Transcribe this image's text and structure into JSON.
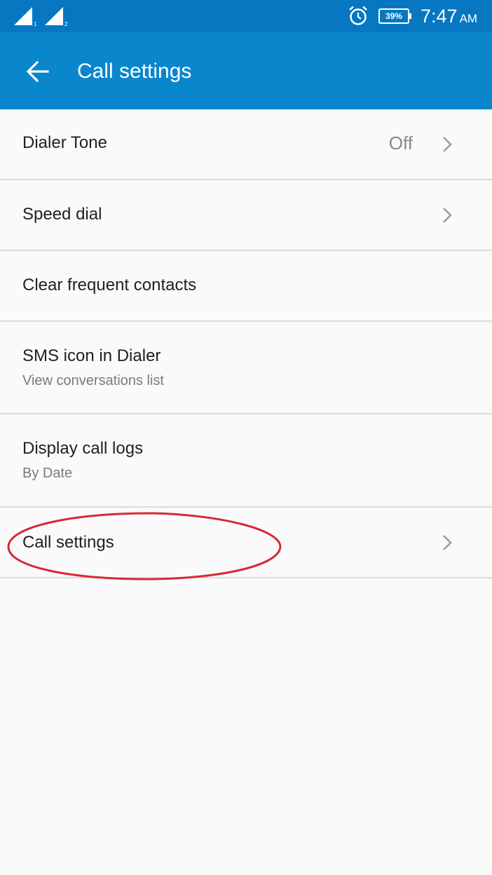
{
  "status_bar": {
    "sim1_label": "1",
    "sim2_label": "2",
    "battery_percent": "39%",
    "time": "7:47",
    "ampm": "AM",
    "icons": [
      "signal-sim1-icon",
      "signal-sim2-icon",
      "alarm-icon",
      "battery-icon"
    ]
  },
  "app_bar": {
    "title": "Call settings",
    "back_icon": "arrow-back-icon",
    "color": "#0a86cd"
  },
  "settings": {
    "dialer_tone": {
      "title": "Dialer Tone",
      "value": "Off"
    },
    "speed_dial": {
      "title": "Speed dial"
    },
    "clear_frequent": {
      "title": "Clear frequent contacts"
    },
    "sms_icon": {
      "title": "SMS icon in Dialer",
      "subtitle": "View conversations list"
    },
    "display_call_logs": {
      "title": "Display call logs",
      "subtitle": "By Date"
    },
    "call_settings": {
      "title": "Call settings"
    }
  },
  "annotation": {
    "shape": "ellipse",
    "color": "#d62a35",
    "highlights": "call_settings"
  }
}
